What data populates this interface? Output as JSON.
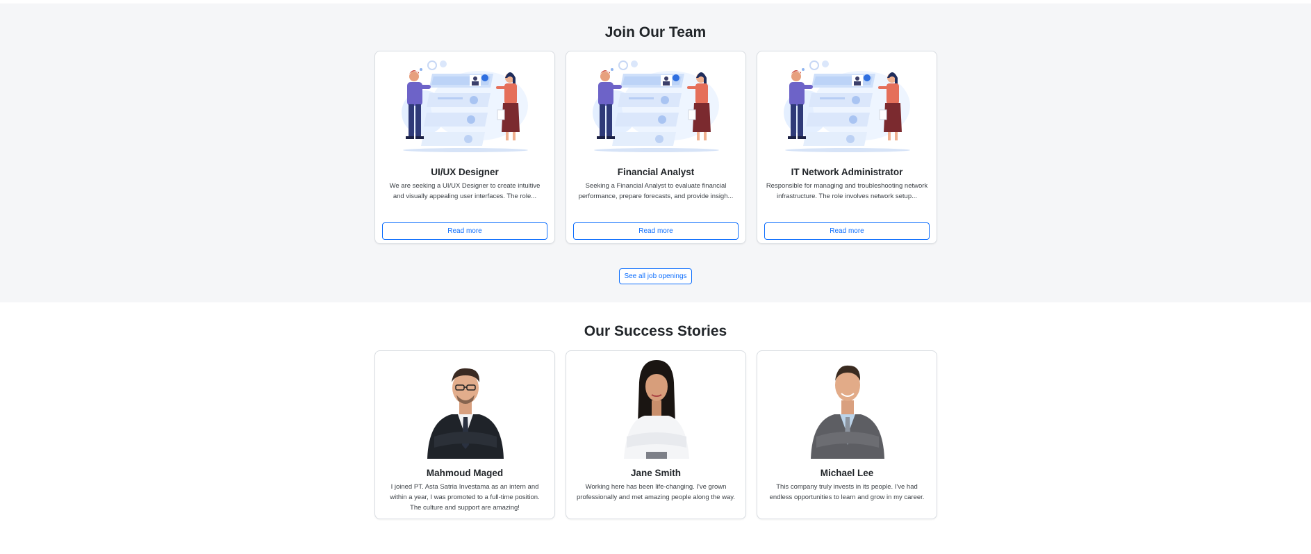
{
  "team": {
    "title": "Join Our Team",
    "jobs": [
      {
        "title": "UI/UX Designer",
        "description": "We are seeking a UI/UX Designer to create intuitive and visually appealing user interfaces. The role...",
        "button": "Read more"
      },
      {
        "title": "Financial Analyst",
        "description": "Seeking a Financial Analyst to evaluate financial performance, prepare forecasts, and provide insigh...",
        "button": "Read more"
      },
      {
        "title": "IT Network Administrator",
        "description": "Responsible for managing and troubleshooting network infrastructure. The role involves network setup...",
        "button": "Read more"
      }
    ],
    "all_button": "See all job openings"
  },
  "stories": {
    "title": "Our Success Stories",
    "people": [
      {
        "name": "Mahmoud Maged",
        "quote": "I joined PT. Asta Satria Investama as an intern and within a year, I was promoted to a full-time position. The culture and support are amazing!"
      },
      {
        "name": "Jane Smith",
        "quote": "Working here has been life-changing. I've grown professionally and met amazing people along the way."
      },
      {
        "name": "Michael Lee",
        "quote": "This company truly invests in its people. I've had endless opportunities to learn and grow in my career."
      }
    ]
  }
}
